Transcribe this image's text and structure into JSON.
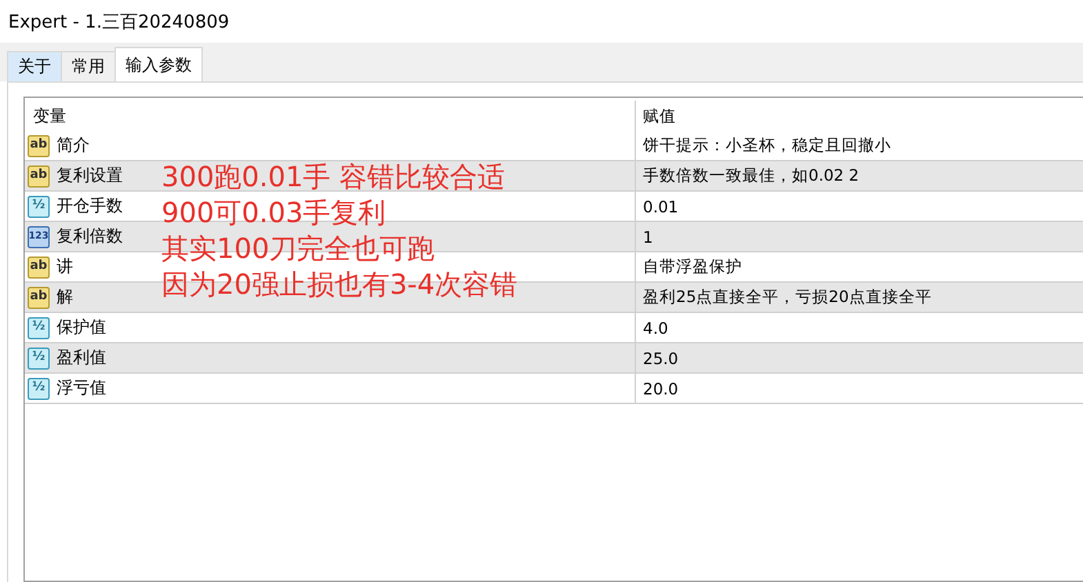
{
  "window": {
    "title": "Expert - 1.三百20240809"
  },
  "tabs": [
    {
      "label": "关于",
      "selected": false,
      "hovered": true
    },
    {
      "label": "常用",
      "selected": false,
      "hovered": false
    },
    {
      "label": "输入参数",
      "selected": true,
      "hovered": false
    }
  ],
  "table": {
    "columns": [
      "变量",
      "赋值"
    ],
    "rows": [
      {
        "kind": "string",
        "icon": "ab",
        "name": "简介",
        "value": "饼干提示：小圣杯，稳定且回撤小"
      },
      {
        "kind": "string",
        "icon": "ab",
        "name": "复利设置",
        "value": "手数倍数一致最佳，如0.02 2"
      },
      {
        "kind": "double",
        "icon": "½",
        "name": "开仓手数",
        "value": "0.01"
      },
      {
        "kind": "int",
        "icon": "123",
        "name": "复利倍数",
        "value": "1"
      },
      {
        "kind": "string",
        "icon": "ab",
        "name": "讲",
        "value": "自带浮盈保护"
      },
      {
        "kind": "string",
        "icon": "ab",
        "name": "解",
        "value": "盈利25点直接全平，亏损20点直接全平"
      },
      {
        "kind": "double",
        "icon": "½",
        "name": "保护值",
        "value": "4.0"
      },
      {
        "kind": "double",
        "icon": "½",
        "name": "盈利值",
        "value": "25.0"
      },
      {
        "kind": "double",
        "icon": "½",
        "name": "浮亏值",
        "value": "20.0"
      }
    ]
  },
  "annotation": [
    "300跑0.01手 容错比较合适",
    "900可0.03手复利",
    "其实100刀完全也可跑",
    "因为20强止损也有3-4次容错"
  ]
}
